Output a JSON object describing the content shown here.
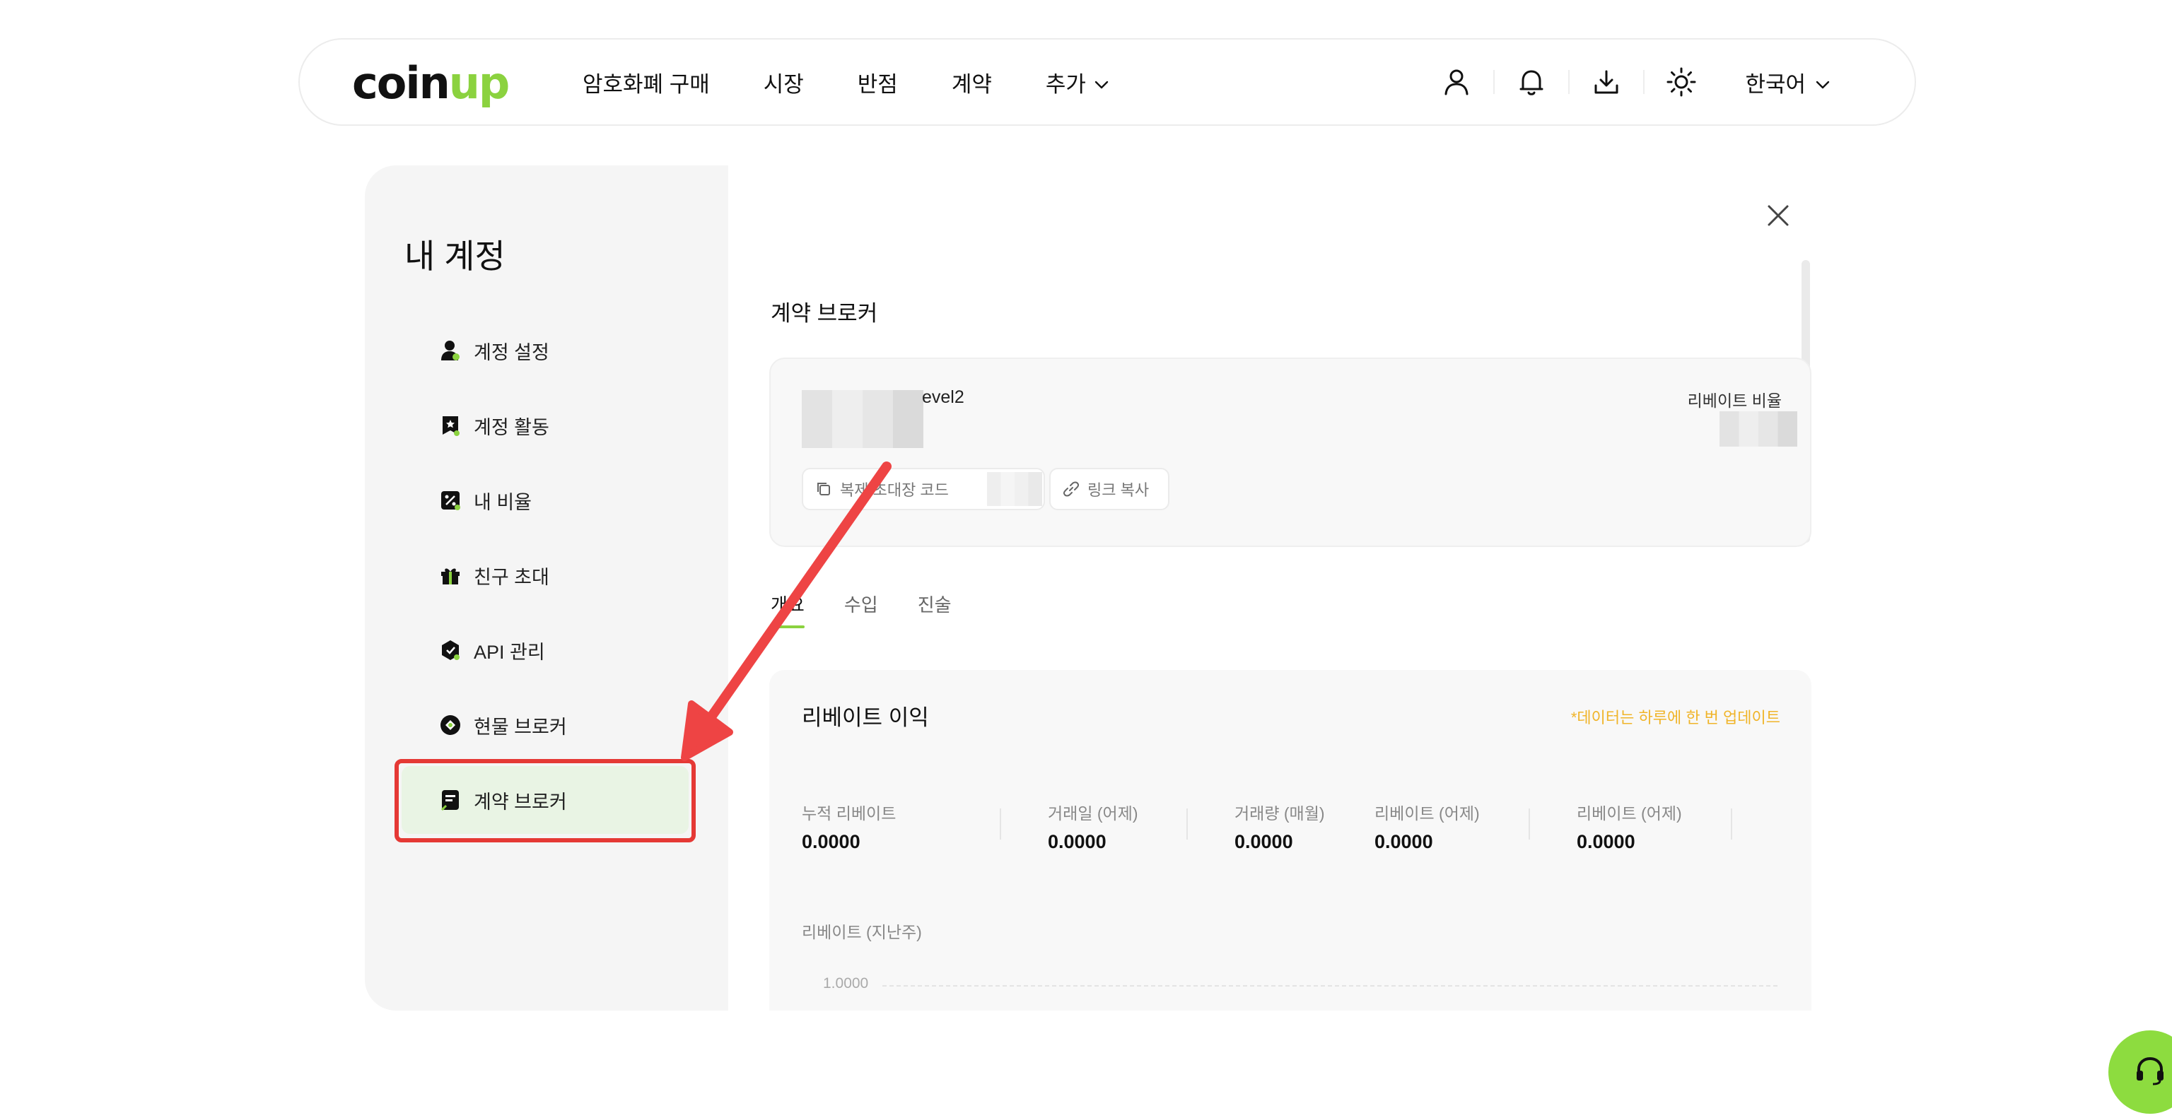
{
  "nav": {
    "logo_main": "coin",
    "logo_accent": "up",
    "links": [
      "암호화폐 구매",
      "시장",
      "반점",
      "계약",
      "추가"
    ],
    "icons": [
      "user-icon",
      "bell-icon",
      "download-icon",
      "sun-icon"
    ],
    "language": "한국어"
  },
  "sidebar": {
    "title": "내 계정",
    "items": [
      {
        "label": "계정 설정",
        "icon": "user-settings-icon"
      },
      {
        "label": "계정 활동",
        "icon": "activity-icon"
      },
      {
        "label": "내 비율",
        "icon": "percent-icon"
      },
      {
        "label": "친구 초대",
        "icon": "gift-icon"
      },
      {
        "label": "API 관리",
        "icon": "api-icon"
      },
      {
        "label": "현물 브로커",
        "icon": "spot-broker-icon"
      },
      {
        "label": "계약 브로커",
        "icon": "contract-broker-icon"
      }
    ],
    "active_index": 6
  },
  "main": {
    "title": "계약 브로커",
    "level": "evel2",
    "rebate_ratio_label": "리베이트 비율",
    "copy_invite_code": "복제 초대장 코드",
    "copy_link": "링크 복사",
    "tabs": [
      "개요",
      "수입",
      "진술"
    ],
    "active_tab": 0,
    "stats": {
      "title": "리베이트 이익",
      "note": "*데이터는 하루에 한 번 업데이트",
      "items": [
        {
          "label": "누적 리베이트",
          "value": "0.0000"
        },
        {
          "label": "거래일 (어제)",
          "value": "0.0000"
        },
        {
          "label": "거래량 (매월)",
          "value": "0.0000"
        },
        {
          "label": "리베이트 (어제)",
          "value": "0.0000"
        },
        {
          "label": "리베이트 (어제)",
          "value": "0.0000"
        }
      ],
      "chart_label": "리베이트 (지난주)",
      "chart_tick": "1.0000"
    }
  },
  "colors": {
    "accent": "#8bd23f",
    "active_bg": "#e9f4e4",
    "note": "#f0b429",
    "annotation": "#e53935"
  }
}
